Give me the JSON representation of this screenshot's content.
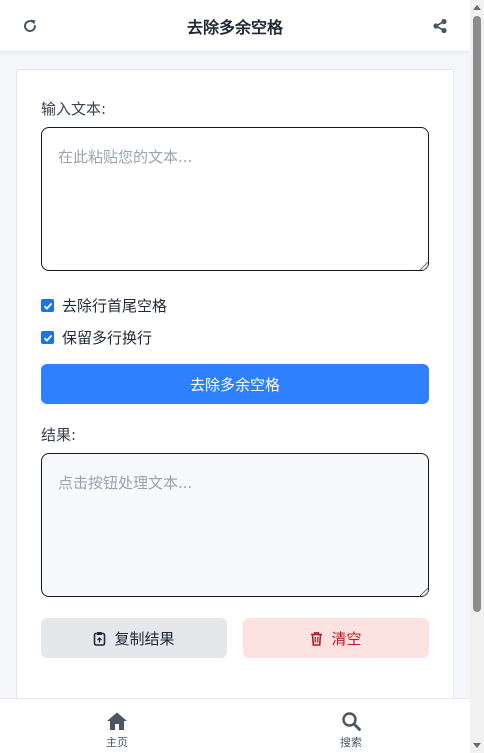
{
  "header": {
    "title": "去除多余空格",
    "left_icon": "refresh-icon",
    "right_icon": "share-icon"
  },
  "input": {
    "label": "输入文本:",
    "placeholder": "在此粘贴您的文本...",
    "value": ""
  },
  "options": [
    {
      "label": "去除行首尾空格",
      "checked": true
    },
    {
      "label": "保留多行换行",
      "checked": true
    }
  ],
  "process_button": {
    "label": "去除多余空格"
  },
  "result": {
    "label": "结果:",
    "placeholder": "点击按钮处理文本...",
    "value": ""
  },
  "actions": {
    "copy": {
      "label": "复制结果",
      "icon": "clipboard-icon"
    },
    "clear": {
      "label": "清空",
      "icon": "trash-icon"
    }
  },
  "nav": {
    "home": {
      "label": "主页",
      "icon": "home-icon"
    },
    "search": {
      "label": "搜索",
      "icon": "search-icon"
    }
  },
  "colors": {
    "primary": "#2f80ff",
    "danger_bg": "#fde2e2",
    "danger_text": "#b91c1c"
  }
}
